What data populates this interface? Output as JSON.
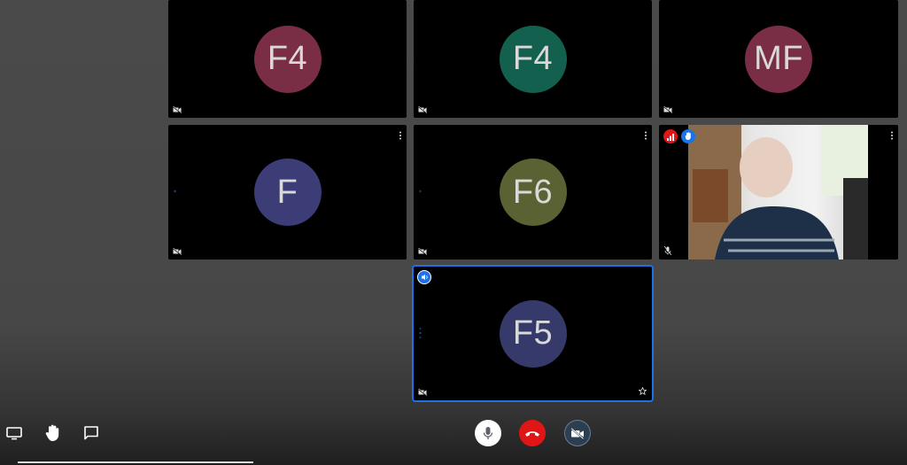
{
  "participants": [
    {
      "initials": "F4",
      "color": "#7a2e45"
    },
    {
      "initials": "F4",
      "color": "#13604f"
    },
    {
      "initials": "MF",
      "color": "#7a2e45"
    },
    {
      "initials": "F",
      "color": "#3c3c76"
    },
    {
      "initials": "F6",
      "color": "#5a6234"
    },
    {
      "initials": "F5",
      "color": "#363a6a"
    }
  ],
  "colors": {
    "tile_bg": "#000000",
    "active_border": "#1a73e8",
    "end_call": "#e01616",
    "mic_button": "#ffffff",
    "camera_button": "#2c3e52"
  },
  "icons": {
    "camera_off": "video-off-icon",
    "mic_off": "mic-off-icon",
    "more": "more-vert-icon",
    "pin": "star-icon",
    "present": "present-screen-icon",
    "raise_hand": "hand-icon",
    "chat": "chat-icon",
    "mic": "mic-icon",
    "hangup": "phone-hangup-icon",
    "camera": "camera-off-icon",
    "signal": "signal-bars-icon",
    "hand_badge": "hand-badge-icon",
    "speaking": "speaker-icon"
  }
}
